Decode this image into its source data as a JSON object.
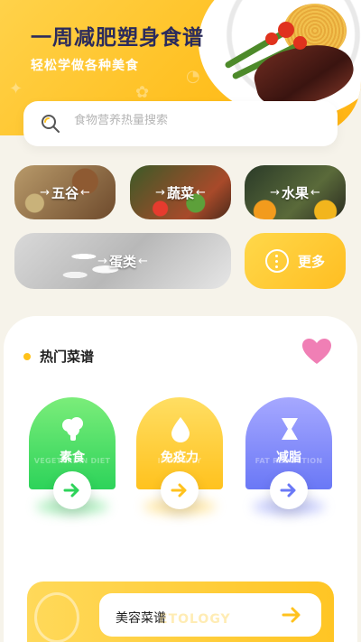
{
  "hero": {
    "title": "一周减肥塑身食谱",
    "subtitle": "轻松学做各种美食"
  },
  "search": {
    "placeholder": "食物营养热量搜索"
  },
  "categories": [
    {
      "label": "五谷"
    },
    {
      "label": "蔬菜"
    },
    {
      "label": "水果"
    },
    {
      "label": "蛋类"
    }
  ],
  "more": {
    "label": "更多"
  },
  "hot": {
    "title": "热门菜谱",
    "cards": [
      {
        "label": "素食",
        "en": "VEGETARIAN DIET",
        "icon": "broccoli-icon"
      },
      {
        "label": "免疫力",
        "en": "IMMUNITY",
        "icon": "water-drop-icon"
      },
      {
        "label": "减脂",
        "en": "FAT REDUCTION",
        "icon": "hourglass-icon"
      }
    ]
  },
  "beauty": {
    "label": "美容菜谱",
    "en": "ETOLOGY"
  },
  "colors": {
    "accent": "#ffc21e",
    "title": "#2b2b5c",
    "green": "#2dd35a",
    "blue": "#6a78f6",
    "heart": "#f07fb5"
  }
}
